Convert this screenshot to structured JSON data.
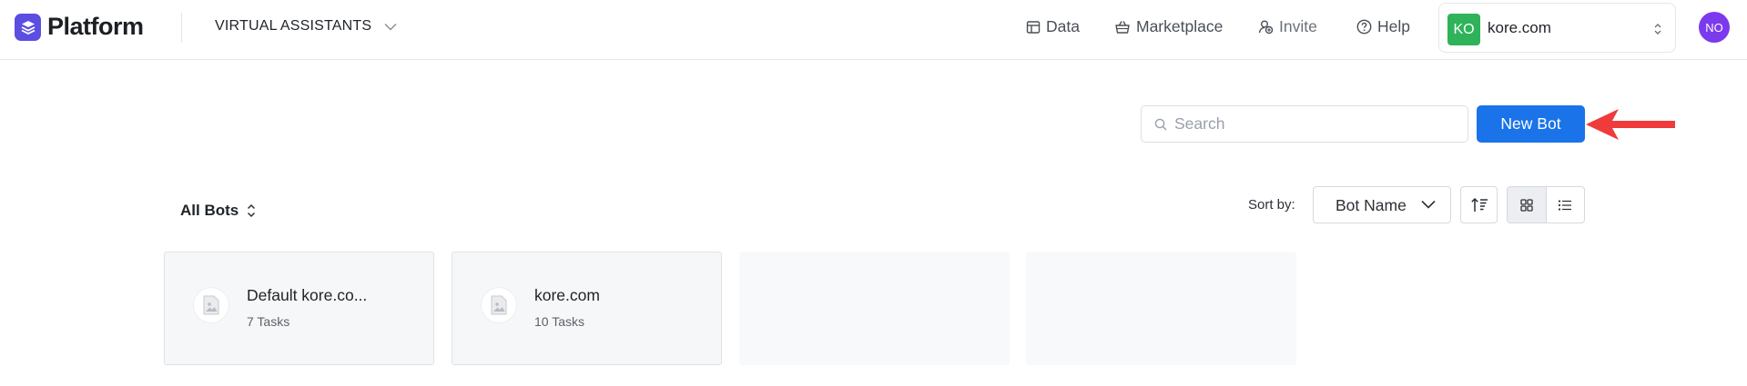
{
  "header": {
    "brand": "Platform",
    "breadcrumb": "VIRTUAL ASSISTANTS",
    "nav": [
      {
        "label": "Data",
        "icon": "table-icon"
      },
      {
        "label": "Marketplace",
        "icon": "basket-icon"
      },
      {
        "label": "Invite",
        "icon": "invite-icon"
      },
      {
        "label": "Help",
        "icon": "help-icon"
      }
    ],
    "account": {
      "initials": "KO",
      "name": "kore.com",
      "badge_color": "#2fb35a"
    },
    "user_initials": "NO",
    "avatar_color": "#7c3aed"
  },
  "toolbar": {
    "search_placeholder": "Search",
    "search_value": "",
    "new_bot_label": "New Bot",
    "filter_label": "All Bots",
    "sort_label": "Sort by:",
    "sort_value": "Bot Name",
    "view_mode": "grid"
  },
  "bots": [
    {
      "name": "Default kore.co...",
      "tasks": "7 Tasks"
    },
    {
      "name": "kore.com",
      "tasks": "10 Tasks"
    }
  ],
  "colors": {
    "primary": "#1a73e8",
    "brand": "#5b4ee0",
    "annotation_arrow": "#ef3b3b"
  }
}
